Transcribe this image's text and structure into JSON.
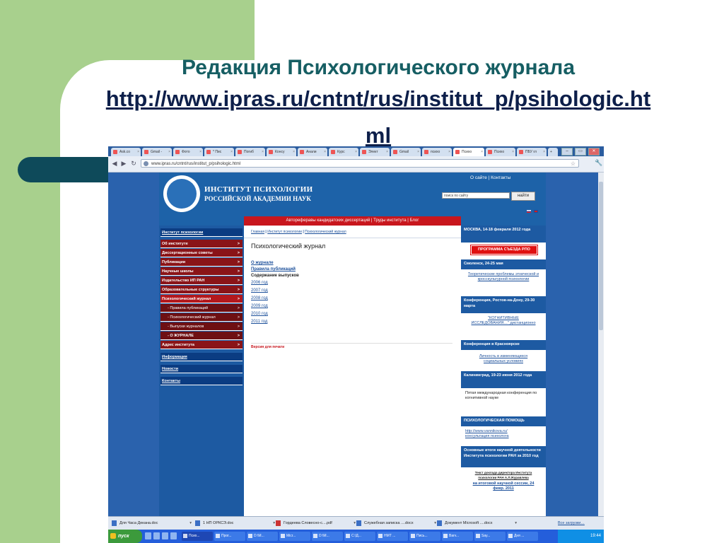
{
  "slide": {
    "title": "Редакция  Психологического  журнала",
    "url_line1": "http://www.ipras.ru/cntnt/rus/institut_p/psihologic.ht",
    "url_line2": "ml"
  },
  "browser": {
    "tabs": [
      {
        "label": "Ask.co",
        "active": false
      },
      {
        "label": "Gmail -",
        "active": false
      },
      {
        "label": "Фото",
        "active": false
      },
      {
        "label": "* Пис",
        "active": false
      },
      {
        "label": "Погиб",
        "active": false
      },
      {
        "label": "Консу",
        "active": false
      },
      {
        "label": "Анали",
        "active": false
      },
      {
        "label": "Курс",
        "active": false
      },
      {
        "label": "Элект",
        "active": false
      },
      {
        "label": "Gmail",
        "active": false
      },
      {
        "label": "психо",
        "active": false
      },
      {
        "label": "Психо",
        "active": true
      },
      {
        "label": "Психо",
        "active": false
      },
      {
        "label": "ПБУ гл",
        "active": false
      }
    ],
    "tab_close": "×",
    "new_tab": "+",
    "win_buttons": [
      "–",
      "▭",
      "✕"
    ],
    "address": "www.ipras.ru/cntnt/rus/institut_p/psihologic.html",
    "back": "◀",
    "forward": "▶",
    "reload": "↻",
    "star": "☆",
    "wrench": "🔧"
  },
  "site": {
    "title1": "ИНСТИТУТ ПСИХОЛОГИИ",
    "title2": "РОССИЙСКОЙ АКАДЕМИИ НАУК",
    "toplinks": "О сайте  |  Контакты",
    "search_placeholder": "поиск по сайту",
    "search_button": "найти",
    "redbar": "Автореферавы кандидатских диссертаций  |  Труды института  |  Блог"
  },
  "leftnav": [
    {
      "label": "Институт психологии",
      "style": "dark"
    },
    {
      "label": "Об институте",
      "style": "red",
      "arrow": ">"
    },
    {
      "label": "Диссертационные советы",
      "style": "red",
      "arrow": ">"
    },
    {
      "label": "Публикации",
      "style": "red",
      "arrow": ">"
    },
    {
      "label": "Научные школы",
      "style": "red",
      "arrow": ">"
    },
    {
      "label": "Издательство ИП РАН",
      "style": "red",
      "arrow": ">"
    },
    {
      "label": "Образовательные структуры",
      "style": "red",
      "arrow": ">"
    },
    {
      "label": "Психологический журнал",
      "style": "red",
      "arrow": ">"
    },
    {
      "label": "- Правила публикаций",
      "style": "sub",
      "arrow": ">"
    },
    {
      "label": "- Психологический журнал",
      "style": "sub",
      "arrow": ">"
    },
    {
      "label": "- Выпуски журналов",
      "style": "sub",
      "arrow": ">"
    },
    {
      "label": "- О ЖУРНАЛЕ",
      "style": "subbold",
      "arrow": ">"
    },
    {
      "label": "Адрес института",
      "style": "red",
      "arrow": ">"
    },
    {
      "label": "Информация",
      "style": "dark"
    },
    {
      "label": "Новости",
      "style": "dark"
    },
    {
      "label": "Контакты",
      "style": "dark"
    }
  ],
  "main": {
    "breadcrumb": [
      "Главная",
      "Институт психологии",
      "Психологический журнал"
    ],
    "breadcrumb_sep": " | ",
    "heading": "Психологический журнал",
    "links": [
      {
        "label": "О журнале",
        "kind": "ub"
      },
      {
        "label": "Правила публикаций",
        "kind": "ub"
      },
      {
        "label": "Содержание выпусков",
        "kind": "b"
      }
    ],
    "years": [
      "2006 год",
      "2007 год",
      "2008 год",
      "2009 год",
      "2010 год",
      "2011 год"
    ],
    "print": "Версия для печати"
  },
  "rightcol": {
    "b1_head": "МОСКВА, 14-18 февраля 2012 года",
    "b1_button": "ПРОГРАММА СЪЕЗДА РПО",
    "b2_head": "Смоленск, 24-25 мая",
    "b2_body": "Теоретические проблемы этнической и кросскультурной психологии",
    "b3_head": "Конференция, Ростов-на-Дону, 29-30 марта",
    "b3_body": "\"КОГНИТИВНЫЕ ИССЛЕДОВАНИЯ…\" дистанционно",
    "b4_head": "Конференция в Красноярске",
    "b4_body": "Личность в изменяющихся социальных условиях",
    "b5_head": "Калининград, 19-23 июня 2012 года",
    "b5_body": "Пятая международная конференция по когнитивной науке",
    "b6_head": "ПСИХОЛОГИЧЕСКАЯ ПОМОЩЬ",
    "b6_body1": "http://www.vannikova.ru/",
    "b6_body2": "консультация психолога",
    "b7_head": "Основные итоги научной деятельности Института психологии РАН за 2010 год",
    "b7_body1": "Текст доклада директора Института психологии РАН А.Л.Журавлева",
    "b7_body2": "на итоговой научной сессии, 24 февр. 2011"
  },
  "downloads": [
    "Для Часа Декана.doc",
    "1 НП ОРКСЭ.doc",
    "Гордеева Словесно-с....pdf",
    "Служебная записка ....docx",
    "Документ Microsoft ....docx"
  ],
  "downloads_all": "Все загрузки…",
  "taskbar": {
    "start": "пуск",
    "tasks": [
      "Псих...",
      "Прог...",
      "D:\\М...",
      "Micr...",
      "D:\\М...",
      "C:\\Д...",
      "НМТ ...",
      "Пись...",
      "Barv...",
      "Say...",
      "Дня ..."
    ],
    "time": "19:44"
  }
}
